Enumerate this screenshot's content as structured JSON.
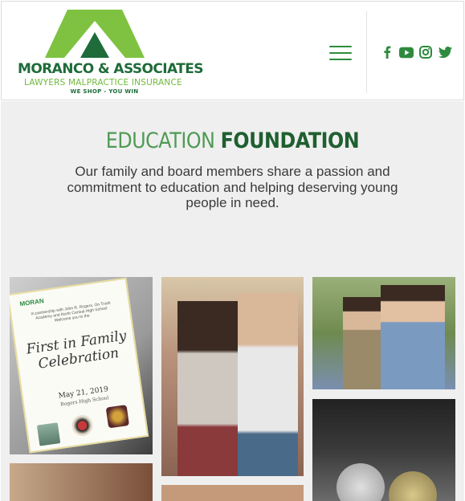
{
  "header": {
    "logo": {
      "name": "MORANCO & ASSOCIATES",
      "subtitle": "LAWYERS MALPRACTICE INSURANCE",
      "tagline": "WE SHOP - YOU WIN",
      "colors": {
        "light_green": "#7fc241",
        "dark_green": "#1f6b3a"
      }
    },
    "menu_icon": "hamburger-icon",
    "social": [
      {
        "name": "facebook-icon"
      },
      {
        "name": "youtube-icon"
      },
      {
        "name": "instagram-icon"
      },
      {
        "name": "twitter-icon"
      }
    ]
  },
  "section": {
    "title_part1": "EDUCATION",
    "title_part2": "FOUNDATION",
    "intro": "Our family and board members share a passion and commitment to education and helping deserving young people in need."
  },
  "gallery": {
    "card": {
      "brand": "MORAN",
      "small_text": "In partnership with John R. Rogers, On Track Academy and North Central High School Welcome you to the",
      "heading": "First in Family Celebration",
      "date": "May 21, 2019",
      "venue": "Rogers High School"
    }
  },
  "colors": {
    "accent": "#2e8b3e",
    "title_light": "#4f9a54",
    "title_dark": "#1f5f30",
    "background": "#efefef"
  }
}
